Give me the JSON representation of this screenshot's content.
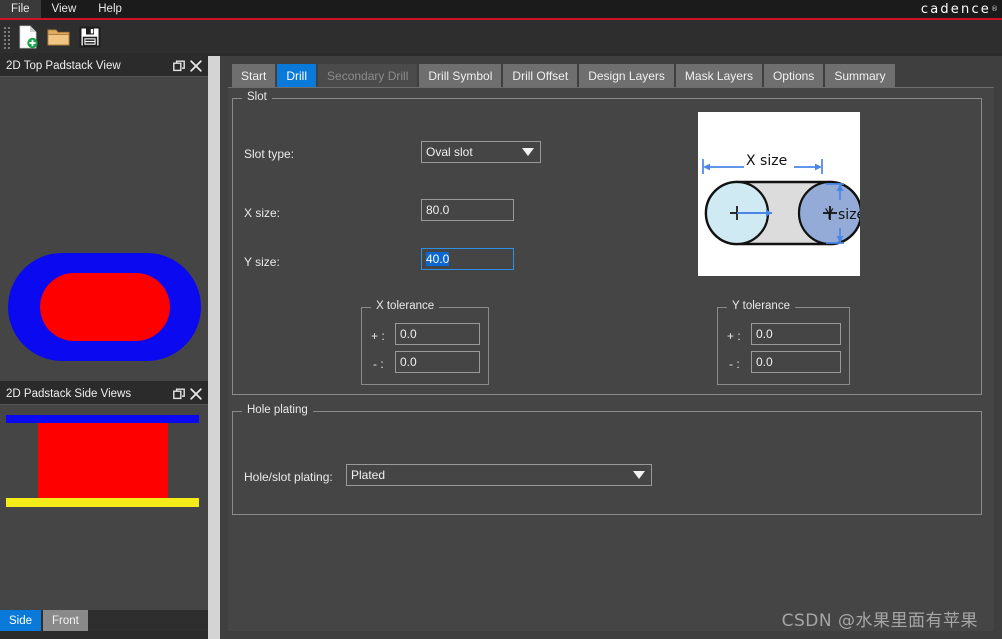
{
  "window": {
    "brand": "cadence",
    "brand_tm": "®",
    "watermark": "CSDN @水果里面有苹果"
  },
  "menubar": {
    "items": [
      {
        "label": "File",
        "name": "menu-file"
      },
      {
        "label": "View",
        "name": "menu-view"
      },
      {
        "label": "Help",
        "name": "menu-help"
      }
    ]
  },
  "toolbar": {
    "buttons": [
      {
        "icon": "new-file-icon",
        "title": "New"
      },
      {
        "icon": "open-folder-icon",
        "title": "Open"
      },
      {
        "icon": "save-disk-icon",
        "title": "Save"
      }
    ]
  },
  "left_dock": {
    "top_panel": {
      "title": "2D Top Padstack View",
      "float_icon": "float-window-icon",
      "close_icon": "close-icon",
      "graphic": {
        "outer_color": "#0b09f0",
        "inner_color": "#fe0000",
        "background": "#454545"
      }
    },
    "side_panel": {
      "title": "2D Padstack Side Views",
      "float_icon": "float-window-icon",
      "close_icon": "close-icon",
      "graphic": {
        "top_bar_color": "#0b09f0",
        "body_color": "#fe0000",
        "bottom_bar_color": "#f4eb18",
        "background": "#454545"
      },
      "tabs": [
        {
          "label": "Side",
          "selected": true
        },
        {
          "label": "Front",
          "selected": false
        }
      ]
    }
  },
  "main": {
    "tabs": [
      {
        "label": "Start",
        "state": "normal"
      },
      {
        "label": "Drill",
        "state": "active"
      },
      {
        "label": "Secondary Drill",
        "state": "disabled"
      },
      {
        "label": "Drill Symbol",
        "state": "normal"
      },
      {
        "label": "Drill Offset",
        "state": "normal"
      },
      {
        "label": "Design Layers",
        "state": "normal"
      },
      {
        "label": "Mask Layers",
        "state": "normal"
      },
      {
        "label": "Options",
        "state": "normal"
      },
      {
        "label": "Summary",
        "state": "normal"
      }
    ],
    "slot_group": {
      "legend": "Slot",
      "slot_type_label": "Slot type:",
      "slot_type_value": "Oval slot",
      "x_size_label": "X size:",
      "x_size_value": "80.0",
      "y_size_label": "Y size:",
      "y_size_value": "40.0",
      "diagram": {
        "x_size_caption": "X size",
        "y_size_caption": "Y size",
        "left_circle_color": "#cfeaf2",
        "right_circle_color": "#93abd6",
        "body_color": "#dcdcdc",
        "dim_color": "#4a86e8"
      },
      "x_tolerance": {
        "legend": "X tolerance",
        "plus_label": "+ :",
        "plus_value": "0.0",
        "minus_label": "- :",
        "minus_value": "0.0"
      },
      "y_tolerance": {
        "legend": "Y tolerance",
        "plus_label": "+ :",
        "plus_value": "0.0",
        "minus_label": "- :",
        "minus_value": "0.0"
      }
    },
    "hole_plating_group": {
      "legend": "Hole plating",
      "plating_label": "Hole/slot plating:",
      "plating_value": "Plated"
    }
  },
  "colors": {
    "accent_blue": "#0a7ada",
    "brand_red": "#cf1126",
    "panel_bg": "#454545",
    "window_bg": "#2b2b2b"
  }
}
